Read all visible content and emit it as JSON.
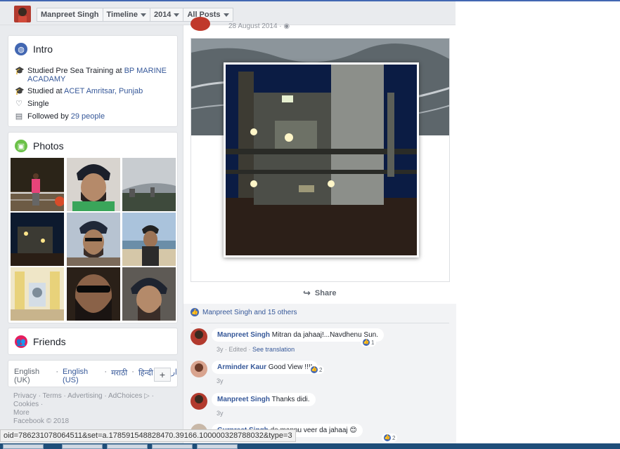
{
  "header": {
    "profile_name": "Manpreet Singh",
    "timeline_label": "Timeline",
    "year_label": "2014",
    "posts_filter": "All Posts"
  },
  "intro": {
    "title": "Intro",
    "studied_sea_prefix": "Studied Pre Sea Training at",
    "studied_sea_link": "BP MARINE ACADAMY",
    "studied_prefix": "Studied at",
    "studied_link": "ACET Amritsar, Punjab",
    "relationship": "Single",
    "followed_prefix": "Followed by",
    "followed_link": "29 people"
  },
  "photos": {
    "title": "Photos"
  },
  "friends": {
    "title": "Friends"
  },
  "languages": {
    "items": [
      "English (UK)",
      "·",
      "English (US)",
      "·",
      "मराठी",
      "·",
      "हिन्दी",
      "·",
      "اردو"
    ],
    "add": "+"
  },
  "footer": {
    "line1": [
      "Privacy",
      "·",
      "Terms",
      "·",
      "Advertising",
      "·",
      "AdChoices ▷",
      "·",
      "Cookies",
      "·"
    ],
    "line2": "More",
    "line3": "Facebook © 2018"
  },
  "post": {
    "date": "28 August 2014 · ◉",
    "share_label": "Share",
    "likes_text": "Manpreet Singh and 15 others"
  },
  "comments": [
    {
      "name": "Manpreet Singh",
      "text": "Mitran da jahaaj!...Navdhenu Sun.",
      "time": "3y",
      "edited": "Edited",
      "translate": "See translation",
      "likes": "1"
    },
    {
      "name": "Arminder Kaur",
      "text": "Good View !!!!",
      "time": "3y",
      "likes": "2"
    },
    {
      "name": "Manpreet Singh",
      "text": "Thanks didi.",
      "time": "3y"
    },
    {
      "name": "Gurpreet Singh",
      "text": "de mannu veer da jahaaj 😊",
      "likes": "2"
    }
  ],
  "statusbar": {
    "url": "oid=786231078064511&set=a.178591548828470.39166.100000328788032&type=3"
  },
  "colors": {
    "fb_blue": "#4267b2",
    "link": "#365899",
    "background": "#e9ebee"
  }
}
